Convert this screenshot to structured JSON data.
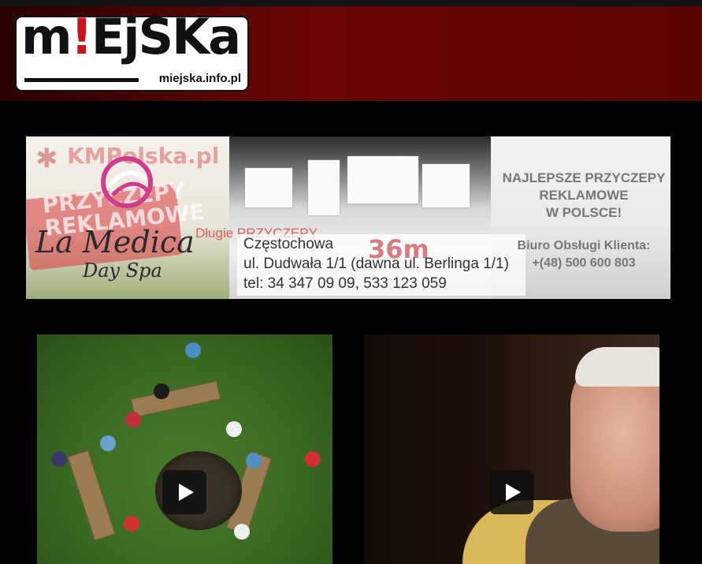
{
  "header": {
    "logo": {
      "word_left": "m",
      "word_mark": "!",
      "word_right": "EjSKa",
      "url": "miejska.info.pl"
    }
  },
  "banner": {
    "kmp_text": "KMPolska.pl",
    "przyczepy_text": "PRZYCZEPY REKLAMOWE",
    "brand_name": "La Medica",
    "brand_tagline": "Day Spa",
    "dlugie_text": "Długie PRZYCZEPY",
    "size_text": "36m",
    "address_lines": [
      "Częstochowa",
      "ul. Dudwała 1/1 (dawna ul. Berlinga 1/1)",
      "tel: 34 347 09 09, 533 123 059"
    ],
    "right_headline": [
      "NAJLEPSZE PRZYCZEPY",
      "REKLAMOWE",
      "W POLSCE!"
    ],
    "right_contact": [
      "Biuro Obsługi Klienta:",
      "+(48) 500 600 803"
    ]
  },
  "videos": [
    {
      "id": "v1",
      "thumbnail": "aerial-group-around-firepit"
    },
    {
      "id": "v2",
      "thumbnail": "elderly-man-portrait"
    }
  ],
  "colors": {
    "header_dark": "#2a0202",
    "header_red": "#6a0606",
    "accent_red": "#c8141c"
  }
}
